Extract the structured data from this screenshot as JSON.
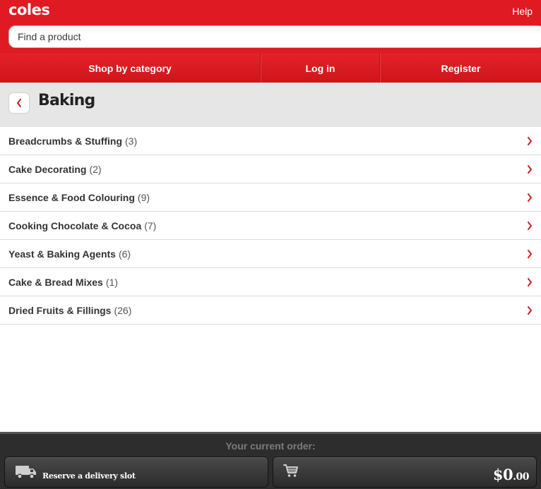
{
  "header": {
    "logo": "coles",
    "help_label": "Help",
    "search_placeholder": "Find a product"
  },
  "nav": {
    "items": [
      {
        "label": "Shop by category"
      },
      {
        "label": "Log in"
      },
      {
        "label": "Register"
      }
    ]
  },
  "page": {
    "title": "Baking",
    "back_icon": "chevron-left-icon"
  },
  "categories": [
    {
      "name": "Breadcrumbs & Stuffing",
      "count": "(3)"
    },
    {
      "name": "Cake Decorating",
      "count": "(2)"
    },
    {
      "name": "Essence & Food Colouring",
      "count": "(9)"
    },
    {
      "name": "Cooking Chocolate & Cocoa",
      "count": "(7)"
    },
    {
      "name": "Yeast & Baking Agents",
      "count": "(6)"
    },
    {
      "name": "Cake & Bread Mixes",
      "count": "(1)"
    },
    {
      "name": "Dried Fruits & Fillings",
      "count": "(26)"
    }
  ],
  "footer": {
    "order_label": "Your current order:",
    "reserve_label": "Reserve a delivery slot",
    "total_dollars": "$0",
    "total_cents": ".00"
  },
  "colors": {
    "brand_red": "#e01a22",
    "chevron_red": "#cc1f26",
    "footer_bg": "#2d2d2d"
  }
}
